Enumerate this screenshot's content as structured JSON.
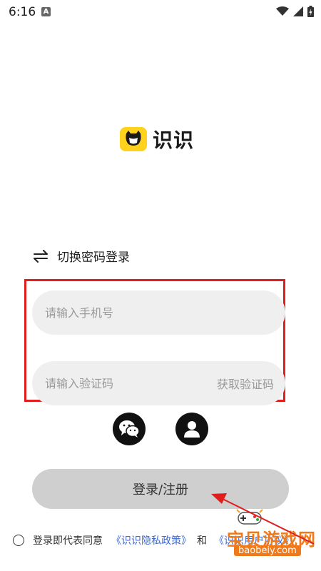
{
  "status_bar": {
    "time": "6:16",
    "notification_icon": "A",
    "icons": [
      "wifi-icon",
      "signal-icon",
      "battery-icon"
    ]
  },
  "app": {
    "name": "识识",
    "brand_color": "#ffd21e"
  },
  "login": {
    "switch_label": "切换密码登录",
    "phone_placeholder": "请输入手机号",
    "code_placeholder": "请输入验证码",
    "get_code_label": "获取验证码",
    "submit_label": "登录/注册",
    "social": [
      "wechat-icon",
      "user-icon"
    ]
  },
  "agreement": {
    "text": "登录即代表同意",
    "privacy_link": "《识识隐私政策》",
    "and": "和",
    "terms_link": "《识识用户协议》"
  },
  "watermark": {
    "title": "宝贝游戏网",
    "url": "baobeiy.com"
  },
  "colors": {
    "highlight_box": "#e01e1e",
    "link": "#3b6ad6",
    "button_bg": "#cfcfcf"
  }
}
